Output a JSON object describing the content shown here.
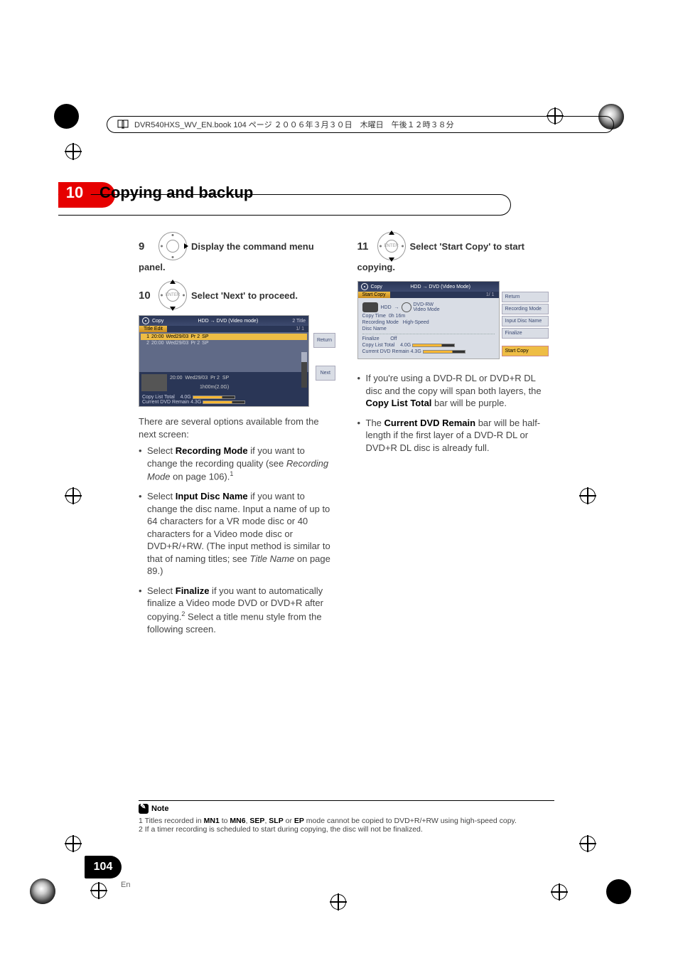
{
  "book_header": "DVR540HXS_WV_EN.book 104 ページ ２００６年３月３０日　木曜日　午後１２時３８分",
  "chapter": {
    "number": "10",
    "title": "Copying and backup"
  },
  "steps": {
    "s9": {
      "num": "9",
      "text_a": "Display the command menu",
      "text_b": "panel."
    },
    "s10": {
      "num": "10",
      "text": "Select 'Next' to proceed."
    },
    "s11": {
      "num": "11",
      "text_a": "Select 'Start Copy' to start",
      "text_b": "copying."
    }
  },
  "screenshot1": {
    "header_copy": "Copy",
    "header_mode": "HDD → DVD (Video mode)",
    "tab_title_edit": "Title Edit",
    "top_right_tab": "2  Title",
    "page_indicator": "1/  1",
    "side_return": "Return",
    "side_next": "Next",
    "rows": [
      {
        "n": "1",
        "time": "20:00",
        "date": "Wed29/03",
        "pr": "Pr 2",
        "mode": "SP"
      },
      {
        "n": "2",
        "time": "20:00",
        "date": "Wed29/03",
        "pr": "Pr 2",
        "mode": "SP"
      }
    ],
    "preview": {
      "time": "20:00",
      "date": "Wed29/03",
      "pr": "Pr 2",
      "mode": "SP",
      "len": "1h00m(2.0G)"
    },
    "footer": {
      "copy_list_total_label": "Copy List Total",
      "copy_list_total_val": "4.0G",
      "current_dvd_remain_label": "Current DVD Remain",
      "current_dvd_remain_val": "4.3G"
    }
  },
  "screenshot2": {
    "header_copy": "Copy",
    "header_mode": "HDD → DVD (Video Mode)",
    "tab": "Start Copy",
    "page_indicator": "1/  1",
    "hdd_label": "HDD",
    "dvd_label1": "DVD-RW",
    "dvd_label2": "Video Mode",
    "copy_time_label": "Copy Time",
    "copy_time_val": "0h 16m",
    "rec_mode_label": "Recording Mode",
    "rec_mode_val": "High-Speed",
    "disc_name_label": "Disc Name",
    "finalize_label": "Finalize",
    "finalize_val": "Off",
    "copy_list_total_label": "Copy List Total",
    "copy_list_total_val": "4.0G",
    "current_dvd_remain_label": "Current DVD Remain",
    "current_dvd_remain_val": "4.3G",
    "side": {
      "return": "Return",
      "rec_mode": "Recording Mode",
      "input_disc_name": "Input Disc Name",
      "finalize": "Finalize",
      "start_copy": "Start Copy"
    }
  },
  "left_body": {
    "intro1": "There are several options available from the",
    "intro2": "next screen:",
    "bullets": {
      "b1a": "Select ",
      "b1b": "Recording Mode",
      "b1c": " if you want to change the recording quality (see ",
      "b1d": "Recording Mode",
      "b1e": " on page 106).",
      "b1sup": "1",
      "b2a": "Select ",
      "b2b": "Input Disc Name",
      "b2c": " if you want to change the disc name. Input a name of up to 64 characters for a VR mode disc or 40 characters for a Video mode disc or DVD+R/+RW. (The input method is similar to that of naming titles; see ",
      "b2d": "Title Name",
      "b2e": " on page 89.)",
      "b3a": "Select ",
      "b3b": "Finalize",
      "b3c": " if you want to automatically finalize a Video mode DVD or DVD+R after copying.",
      "b3sup": "2",
      "b3d": " Select a title menu style from the following screen."
    }
  },
  "right_body": {
    "bullets": {
      "b1a": "If you're using a DVD-R DL or DVD+R DL disc and the copy will span both layers, the ",
      "b1b": "Copy List Total",
      "b1c": " bar will be purple.",
      "b2a": "The ",
      "b2b": "Current DVD Remain",
      "b2c": " bar will be half-length if the first layer of a DVD-R DL or DVD+R DL disc is already full."
    }
  },
  "note": {
    "label": "Note",
    "n1a": "1 Titles recorded in ",
    "n1b": "MN1",
    "n1c": " to ",
    "n1d": "MN6",
    "n1e": ", ",
    "n1f": "SEP",
    "n1g": ", ",
    "n1h": "SLP",
    "n1i": " or ",
    "n1j": "EP",
    "n1k": " mode cannot be copied to DVD+R/+RW using high-speed copy.",
    "n2": "2 If a timer recording is scheduled to start during copying, the disc will not be finalized."
  },
  "page": {
    "number": "104",
    "lang": "En"
  },
  "enter_label": "ENTER"
}
